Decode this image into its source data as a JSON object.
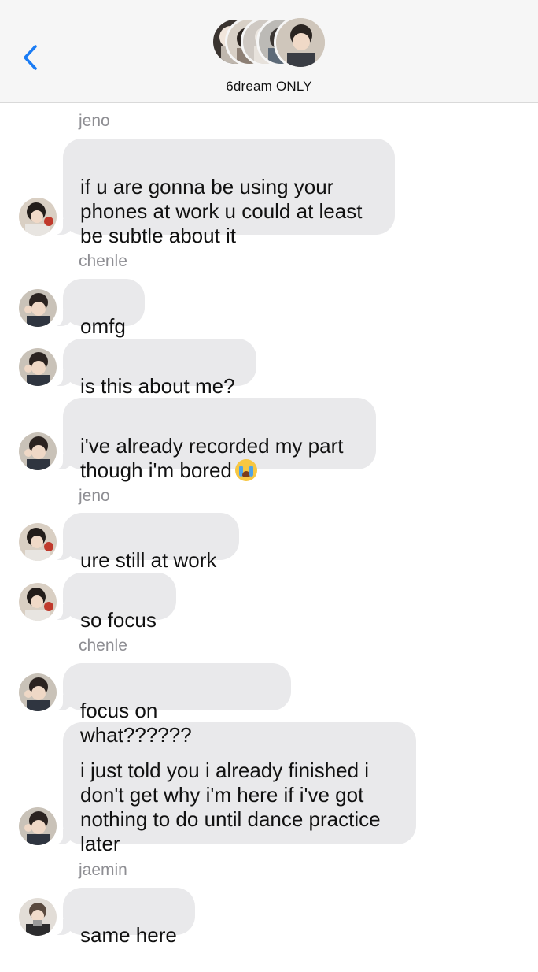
{
  "header": {
    "group_name": "6dream ONLY",
    "avatars": [
      "member-1",
      "member-2",
      "member-3",
      "member-4",
      "member-5"
    ]
  },
  "messages": [
    {
      "sender": "jeno",
      "text": "if u are gonna be using your\nphones at work u could at least\nbe subtle about it"
    },
    {
      "sender": "chenle",
      "text": "omfg"
    },
    {
      "sender": "chenle",
      "text": "is this about me?"
    },
    {
      "sender": "chenle",
      "text": "i've already recorded my part\nthough i'm bored",
      "emoji": "loudly-crying-face"
    },
    {
      "sender": "jeno",
      "text": "ure still at work"
    },
    {
      "sender": "jeno",
      "text": "so focus"
    },
    {
      "sender": "chenle",
      "text": "focus on what??????"
    },
    {
      "sender": "chenle",
      "text": "i just told you i already finished i\ndon't get why i'm here if i've got\nnothing to do until dance practice\nlater"
    },
    {
      "sender": "jaemin",
      "text": "same here"
    }
  ],
  "sender_labels": {
    "label_1": "jeno",
    "label_2": "chenle",
    "label_3": "jeno",
    "label_4": "chenle",
    "label_5": "jaemin"
  },
  "colors": {
    "accent": "#1a7cf5",
    "bubble": "#e9e9eb",
    "sender_label": "#8e8e93",
    "header_bg": "#f6f6f6"
  }
}
